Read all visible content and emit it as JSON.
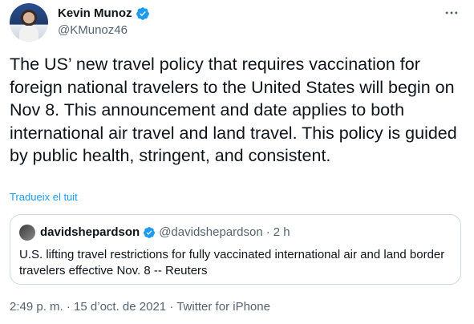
{
  "author": {
    "name": "Kevin Munoz",
    "handle": "@KMunoz46"
  },
  "icons": {
    "verified": "verified-badge-icon",
    "more": "more-options-icon"
  },
  "tweet": {
    "text": "The US’ new travel policy that requires vaccination for foreign national travelers to the United States will begin on Nov 8. This announcement and date applies to both international air travel and land travel. This policy is guided by public health, stringent, and consistent.",
    "translate_label": "Tradueix el tuit"
  },
  "quoted": {
    "name": "davidshepardson",
    "handle": "@davidshepardson",
    "separator": "·",
    "time": "2 h",
    "text": "U.S. lifting travel restrictions for fully vaccinated international air and land border travelers effective Nov. 8 -- Reuters"
  },
  "meta": {
    "time": "2:49 p. m.",
    "separator1": "·",
    "date": "15 d’oct. de 2021",
    "separator2": "·",
    "source": "Twitter for iPhone"
  },
  "colors": {
    "accent": "#1d9bf0",
    "secondary_text": "#536471",
    "primary_text": "#0f1419",
    "border": "#cfd9de"
  }
}
